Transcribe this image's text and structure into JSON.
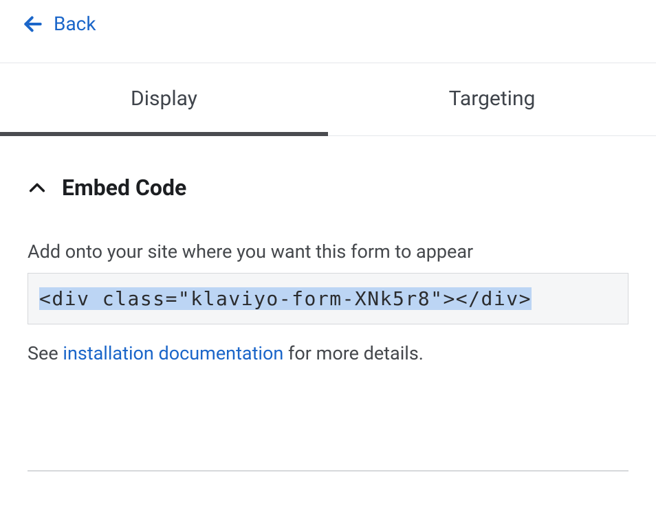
{
  "header": {
    "back_label": "Back"
  },
  "tabs": {
    "display": "Display",
    "targeting": "Targeting"
  },
  "embed_section": {
    "title": "Embed Code",
    "description": "Add onto your site where you want this form to appear",
    "code": "<div class=\"klaviyo-form-XNk5r8\"></div>",
    "help_prefix": "See ",
    "help_link": "installation documentation",
    "help_suffix": " for more details."
  }
}
